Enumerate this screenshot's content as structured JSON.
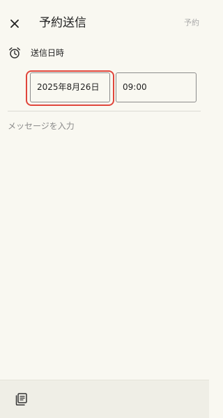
{
  "header": {
    "title": "予約送信",
    "reserve_label": "予約"
  },
  "schedule": {
    "label": "送信日時",
    "date": "2025年8月26日",
    "time": "09:00"
  },
  "message": {
    "placeholder": "メッセージを入力",
    "value": ""
  },
  "icons": {
    "close": "close-icon",
    "alarm": "alarm-clock-icon",
    "template": "template-stack-icon"
  },
  "colors": {
    "background": "#f9f8f1",
    "highlight": "#e0453b",
    "disabled_text": "#aaaaaa"
  }
}
